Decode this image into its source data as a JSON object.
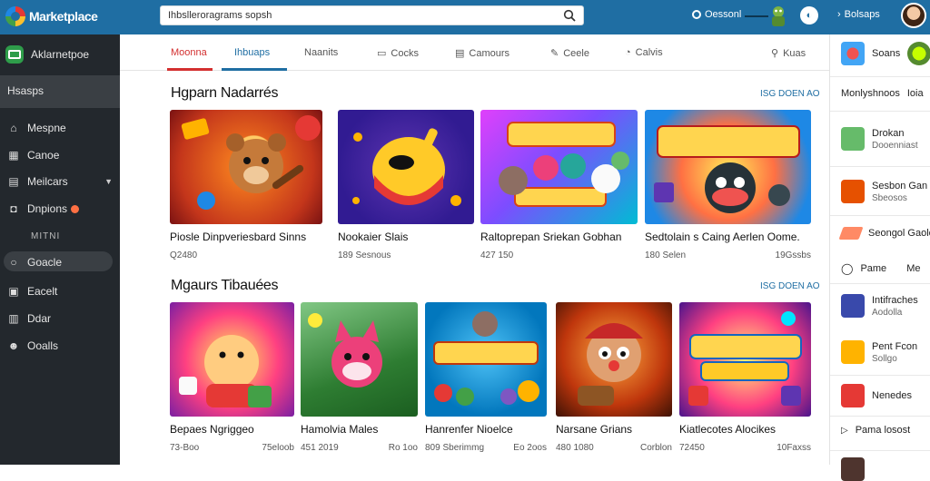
{
  "app": {
    "name": "Marketplace",
    "search_value": "Ihbslleroragrams sopsh",
    "status_label": "Oessonl",
    "user_menu_label": "Bolsaps"
  },
  "sidebar": {
    "brand": "Aklarnetpoe",
    "active_section": "Hsasps",
    "items": [
      {
        "label": "Mespne",
        "icon": "home-icon"
      },
      {
        "label": "Canoe",
        "icon": "grid-icon"
      },
      {
        "label": "Meilcars",
        "icon": "bookmark-icon",
        "chevron": true
      },
      {
        "label": "Dnpions",
        "icon": "chat-icon",
        "badge": true
      },
      {
        "label": "Goacle",
        "icon": "search-icon",
        "highlighted": true
      },
      {
        "label": "Eacelt",
        "icon": "image-icon"
      },
      {
        "label": "Ddar",
        "icon": "bag-icon"
      },
      {
        "label": "Ooalls",
        "icon": "user-icon"
      }
    ],
    "subhead": "MITNI"
  },
  "tabs": [
    {
      "label": "Moonna",
      "state": "active-red"
    },
    {
      "label": "Ihbuaps",
      "state": "active-blue"
    },
    {
      "label": "Naanits",
      "icon": ""
    },
    {
      "label": "Cocks",
      "icon": "card-icon"
    },
    {
      "label": "Camours",
      "icon": "folder-icon"
    },
    {
      "label": "Ceele",
      "icon": "pen-icon"
    },
    {
      "label": "Calvis",
      "icon": "palette-icon"
    },
    {
      "label": "Kuas",
      "icon": "tool-icon"
    }
  ],
  "sections": [
    {
      "title": "Hgparn Nadarrés",
      "see_all": "ISG DOEN AO",
      "cards": [
        {
          "title": "Piosle Dinpveriesbard Sinns",
          "meta_left": "Q2480",
          "meta_right": ""
        },
        {
          "title": "Nookaier Slais",
          "meta_left": "189 Sesnous",
          "meta_right": ""
        },
        {
          "title": "Raltoprepan Sriekan Gobhan",
          "meta_left": "427 150",
          "meta_right": ""
        },
        {
          "title": "Sedtolain s Caing Aerlen Oome.",
          "meta_left": "180 Selen",
          "meta_right": "19Gssbs"
        }
      ]
    },
    {
      "title": "Mgaurs Tibauées",
      "see_all": "ISG DOEN AO",
      "cards": [
        {
          "title": "Bepaes Ngriggeo",
          "meta_left": "73-Boo",
          "meta_right": "75eloob"
        },
        {
          "title": "Hamolvia Males",
          "meta_left": "451 2019",
          "meta_right": "Ro 1oo"
        },
        {
          "title": "Hanrenfer Nioelce",
          "meta_left": "809 Sberimmg",
          "meta_right": "Eo 2oos"
        },
        {
          "title": "Narsane Grians",
          "meta_left": "480 1080",
          "meta_right": "Corblon"
        },
        {
          "title": "Kiatlecotes Alocikes",
          "meta_left": "72450",
          "meta_right": "10Faxss"
        }
      ]
    }
  ],
  "right_panel": {
    "header": "Soans",
    "subheader": "Monlyshnoos",
    "subheader_extra": "Ioia",
    "items": [
      {
        "title": "Drokan",
        "sub": "Dooenniast",
        "color": "#66bb6a"
      },
      {
        "title": "Sesbon Gan",
        "sub": "Sbeosos",
        "color": "#e65100"
      },
      {
        "title": "Seongol Gaole",
        "sub": "",
        "color": "#ff8a65"
      },
      {
        "title": "Intifraches",
        "sub": "Aodolla",
        "color": "#3949ab"
      },
      {
        "title": "Pent Fcon",
        "sub": "Sollgo",
        "color": "#ffb300"
      },
      {
        "title": "Nenedes",
        "sub": "",
        "color": "#e53935"
      }
    ],
    "inline_labels": [
      "Pame",
      "Me"
    ],
    "footer_label": "Pama losost"
  },
  "colors": {
    "topbar": "#1f6ea3",
    "sidebar": "#23282d",
    "accent_red": "#d32f2f",
    "accent_blue": "#1f6ea3"
  }
}
